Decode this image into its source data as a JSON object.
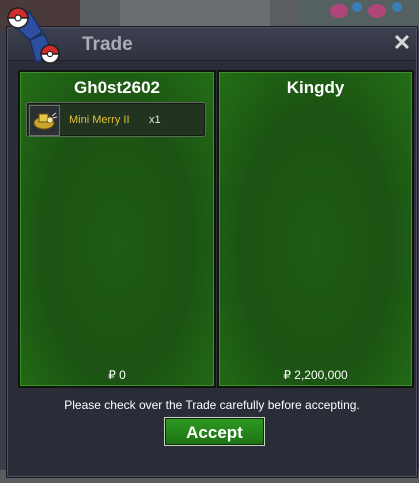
{
  "window": {
    "title": "Trade",
    "close_label": "✕"
  },
  "left_trader": {
    "name": "Gh0st2602",
    "items": [
      {
        "name": "Mini Merry II",
        "quantity": "x1",
        "icon": "mini-merry-icon"
      }
    ],
    "money": "₽ 0"
  },
  "right_trader": {
    "name": "Kingdy",
    "items": [],
    "money": "₽ 2,200,000"
  },
  "footer": {
    "note": "Please check over the Trade carefully before accepting.",
    "accept_label": "Accept"
  },
  "colors": {
    "panel_green": "#1f5c14",
    "accept_green": "#2f9a22",
    "item_name": "#e0c23a",
    "window_bg": "#2a2c38"
  }
}
